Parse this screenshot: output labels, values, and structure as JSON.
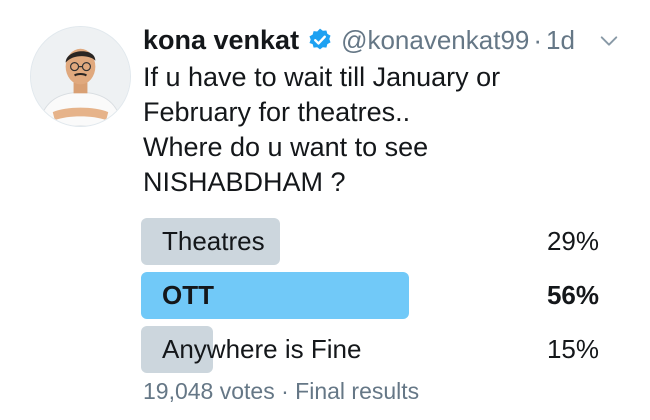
{
  "tweet": {
    "display_name": "kona venkat",
    "handle": "@konavenkat99",
    "separator": "·",
    "time": "1d",
    "text_lines": [
      "If u have to wait till January or",
      "February for theatres..",
      "Where do u want to see",
      "NISHABDHAM ?"
    ],
    "icons": {
      "verified": "verified-badge-icon",
      "menu": "chevron-down-icon"
    },
    "colors": {
      "verified": "#1da1f2",
      "winner_bar": "#71c9f8",
      "other_bar": "#ccd6dd",
      "muted_text": "#657786"
    }
  },
  "poll": {
    "options": [
      {
        "label": "Theatres",
        "percent_text": "29%",
        "percent": 29,
        "winner": false
      },
      {
        "label": "OTT",
        "percent_text": "56%",
        "percent": 56,
        "winner": true
      },
      {
        "label": "Anywhere is Fine",
        "percent_text": "15%",
        "percent": 15,
        "winner": false
      }
    ],
    "votes": "19,048 votes",
    "separator": "·",
    "status": "Final results"
  }
}
